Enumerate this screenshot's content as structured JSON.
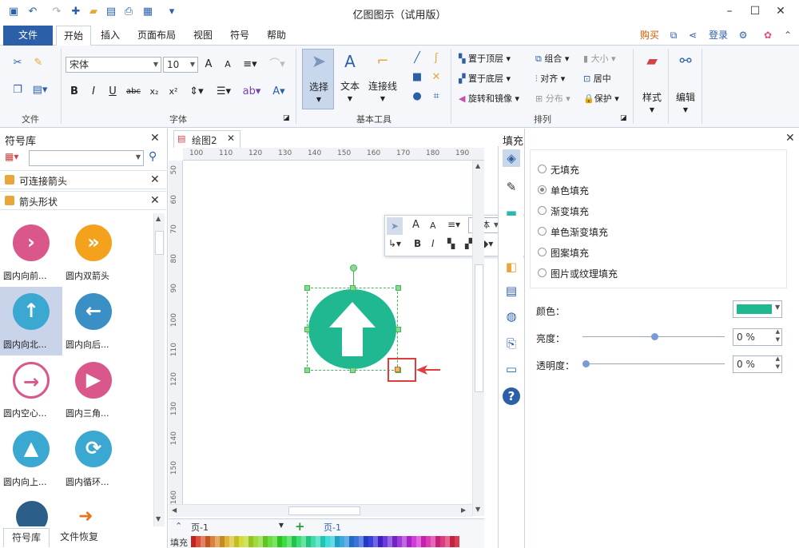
{
  "app": {
    "title": "亿图图示（试用版）"
  },
  "menu": {
    "file": "文件",
    "items": [
      "开始",
      "插入",
      "页面布局",
      "视图",
      "符号",
      "帮助"
    ],
    "buy": "购买",
    "login": "登录"
  },
  "ribbon": {
    "file_group": "文件",
    "font_group": "字体",
    "font_name": "宋体",
    "font_size": "10",
    "basic_tools_group": "基本工具",
    "select": "选择",
    "text": "文本",
    "connector": "连接线",
    "arrange_group": "排列",
    "bring_front": "置于顶层",
    "send_back": "置于底层",
    "rotate_mirror": "旋转和镜像",
    "group": "组合",
    "align": "对齐",
    "distribute": "分布",
    "size": "大小",
    "center": "居中",
    "protect": "保护",
    "style": "样式",
    "edit": "编辑"
  },
  "library": {
    "title": "符号库",
    "rows": [
      "可连接箭头",
      "箭头形状"
    ],
    "shapes": [
      {
        "caption": "圆内向前...",
        "color": "#d9578a",
        "icon": "›"
      },
      {
        "caption": "圆内双箭头",
        "color": "#f4a21c",
        "icon": "»"
      },
      {
        "caption": "圆内向北...",
        "color": "#3aa8d0",
        "icon": "↑"
      },
      {
        "caption": "圆内向后...",
        "color": "#3a8fc4",
        "icon": "←"
      },
      {
        "caption": "圆内空心...",
        "color": "#d9578a",
        "icon": "→"
      },
      {
        "caption": "圆内三角...",
        "color": "#d9578a",
        "icon": "▶"
      },
      {
        "caption": "圆内向上...",
        "color": "#3aa8d0",
        "icon": "▲"
      },
      {
        "caption": "圆内循环...",
        "color": "#3aa8d0",
        "icon": "⟳"
      }
    ],
    "tabs": [
      "符号库",
      "文件恢复"
    ]
  },
  "canvas": {
    "tab": "绘图2",
    "ruler_h": [
      "100",
      "110",
      "120",
      "130",
      "140",
      "150",
      "160",
      "170",
      "180",
      "190"
    ],
    "ruler_v": [
      "50",
      "60",
      "70",
      "80",
      "90",
      "100",
      "110",
      "120",
      "130",
      "140",
      "150",
      "160"
    ],
    "shape_color": "#1fb891",
    "page_label": "页-1",
    "page_tab": "页-1",
    "fill_label": "填充"
  },
  "minitoolbar": {
    "font": "宋体"
  },
  "fill": {
    "title": "填充",
    "options": [
      "无填充",
      "单色填充",
      "渐变填充",
      "单色渐变填充",
      "图案填充",
      "图片或纹理填充"
    ],
    "color_label": "颜色：",
    "color": "#1fb891",
    "brightness_label": "亮度：",
    "brightness_value": "0 %",
    "transparency_label": "透明度：",
    "transparency_value": "0 %"
  }
}
